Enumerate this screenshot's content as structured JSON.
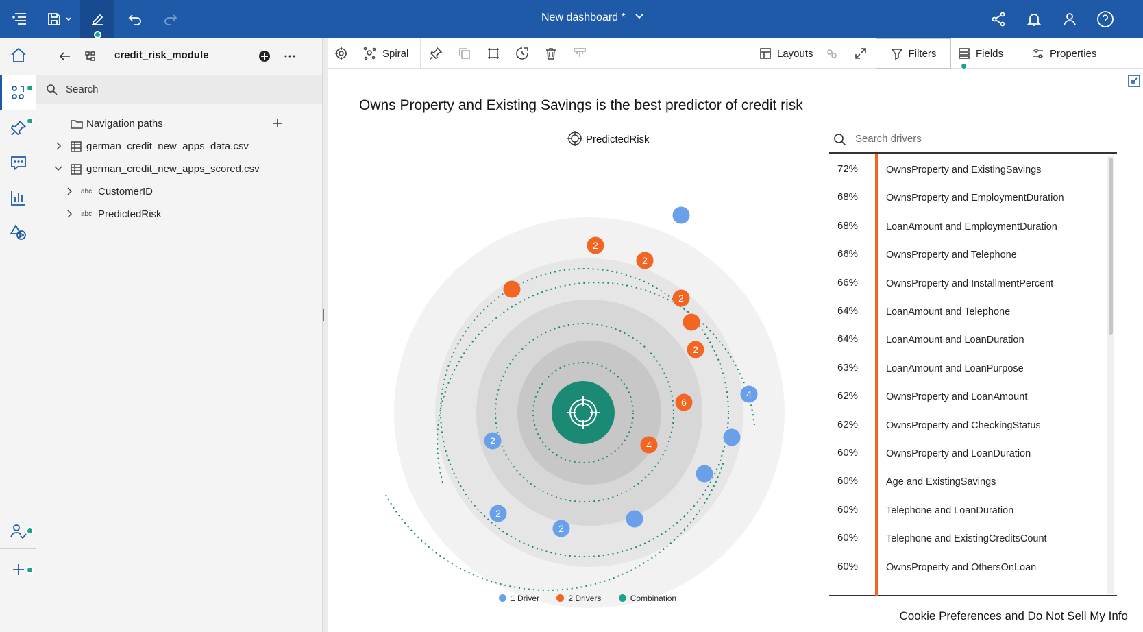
{
  "topbar": {
    "title": "New dashboard *",
    "icons": [
      "menu-icon",
      "save-icon",
      "edit-icon",
      "undo-icon",
      "redo-icon",
      "share-icon",
      "notification-icon",
      "user-icon",
      "help-icon"
    ]
  },
  "panel": {
    "title": "credit_risk_module",
    "search_placeholder": "Search",
    "tree": [
      {
        "label": "Navigation paths",
        "icon": "folder-icon"
      },
      {
        "label": "german_credit_new_apps_data.csv",
        "icon": "table-icon",
        "expanded": false
      },
      {
        "label": "german_credit_new_apps_scored.csv",
        "icon": "table-icon",
        "expanded": true
      },
      {
        "label": "CustomerID",
        "icon": "abc-icon",
        "prefix": "abc"
      },
      {
        "label": "PredictedRisk",
        "icon": "abc-icon",
        "prefix": "abc"
      }
    ]
  },
  "toolbar": {
    "visualization_label": "Spiral",
    "layouts_label": "Layouts",
    "filters_label": "Filters",
    "fields_label": "Fields",
    "properties_label": "Properties"
  },
  "insight": {
    "title": "Owns Property and Existing Savings is the best predictor of credit risk",
    "target_label": "PredictedRisk",
    "legend": {
      "one_driver": "1 Driver",
      "two_drivers": "2 Drivers",
      "combination": "Combination"
    },
    "colors": {
      "one_driver": "#6aa0ea",
      "two_drivers": "#f26522",
      "combination": "#1aa58a"
    },
    "node_labels": [
      "2",
      "2",
      "2",
      "2",
      "6",
      "4",
      "4",
      "2",
      "2",
      "2"
    ]
  },
  "drivers": {
    "search_placeholder": "Search drivers",
    "items": [
      {
        "pct": "72%",
        "name": "OwnsProperty and ExistingSavings"
      },
      {
        "pct": "68%",
        "name": "OwnsProperty and EmploymentDuration"
      },
      {
        "pct": "68%",
        "name": "LoanAmount and EmploymentDuration"
      },
      {
        "pct": "66%",
        "name": "OwnsProperty and Telephone"
      },
      {
        "pct": "66%",
        "name": "OwnsProperty and InstallmentPercent"
      },
      {
        "pct": "64%",
        "name": "LoanAmount and Telephone"
      },
      {
        "pct": "64%",
        "name": "LoanAmount and LoanDuration"
      },
      {
        "pct": "63%",
        "name": "LoanAmount and LoanPurpose"
      },
      {
        "pct": "62%",
        "name": "OwnsProperty and LoanAmount"
      },
      {
        "pct": "62%",
        "name": "OwnsProperty and CheckingStatus"
      },
      {
        "pct": "60%",
        "name": "OwnsProperty and LoanDuration"
      },
      {
        "pct": "60%",
        "name": "Age and ExistingSavings"
      },
      {
        "pct": "60%",
        "name": "Telephone and LoanDuration"
      },
      {
        "pct": "60%",
        "name": "Telephone and ExistingCreditsCount"
      },
      {
        "pct": "60%",
        "name": "OwnsProperty and OthersOnLoan"
      }
    ]
  },
  "cookie_text": "Cookie Preferences and Do Not Sell My Info"
}
